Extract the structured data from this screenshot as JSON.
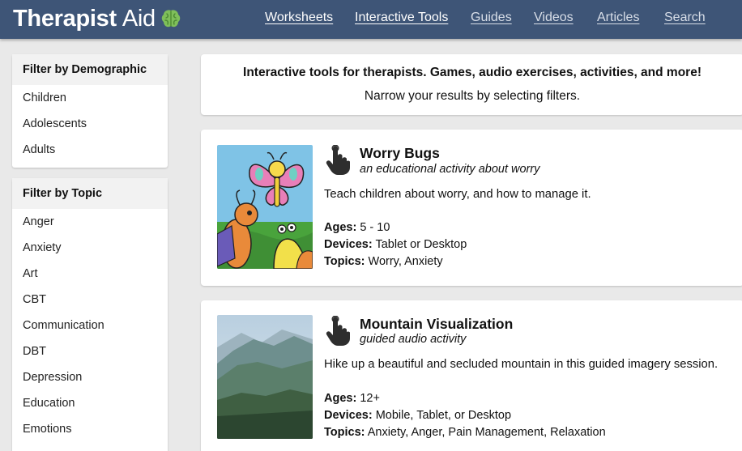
{
  "header": {
    "logo_word1": "Therapist",
    "logo_word2": "Aid",
    "nav": [
      {
        "label": "Worksheets"
      },
      {
        "label": "Interactive Tools"
      },
      {
        "label": "Guides"
      },
      {
        "label": "Videos"
      },
      {
        "label": "Articles"
      },
      {
        "label": "Search"
      }
    ]
  },
  "sidebar": {
    "demographic": {
      "title": "Filter by Demographic",
      "items": [
        "Children",
        "Adolescents",
        "Adults"
      ]
    },
    "topic": {
      "title": "Filter by Topic",
      "items": [
        "Anger",
        "Anxiety",
        "Art",
        "CBT",
        "Communication",
        "DBT",
        "Depression",
        "Education",
        "Emotions"
      ]
    }
  },
  "intro": {
    "line1": "Interactive tools for therapists. Games, audio exercises, activities, and more!",
    "line2": "Narrow your results by selecting filters."
  },
  "tools": [
    {
      "title": "Worry Bugs",
      "subtitle": "an educational activity about worry",
      "description": "Teach children about worry, and how to manage it.",
      "ages_label": "Ages:",
      "ages": "5 - 10",
      "devices_label": "Devices:",
      "devices": "Tablet or Desktop",
      "topics_label": "Topics:",
      "topics": "Worry, Anxiety"
    },
    {
      "title": "Mountain Visualization",
      "subtitle": "guided audio activity",
      "description": "Hike up a beautiful and secluded mountain in this guided imagery session.",
      "ages_label": "Ages:",
      "ages": "12+",
      "devices_label": "Devices:",
      "devices": "Mobile, Tablet, or Desktop",
      "topics_label": "Topics:",
      "topics": "Anxiety, Anger, Pain Management, Relaxation"
    }
  ],
  "colors": {
    "header_bg": "#3e5577",
    "page_bg": "#e9e9e9",
    "brain": "#7fbf5a"
  },
  "icons": {
    "brain": "brain-icon",
    "interactive": "hand-pointer-icon"
  }
}
